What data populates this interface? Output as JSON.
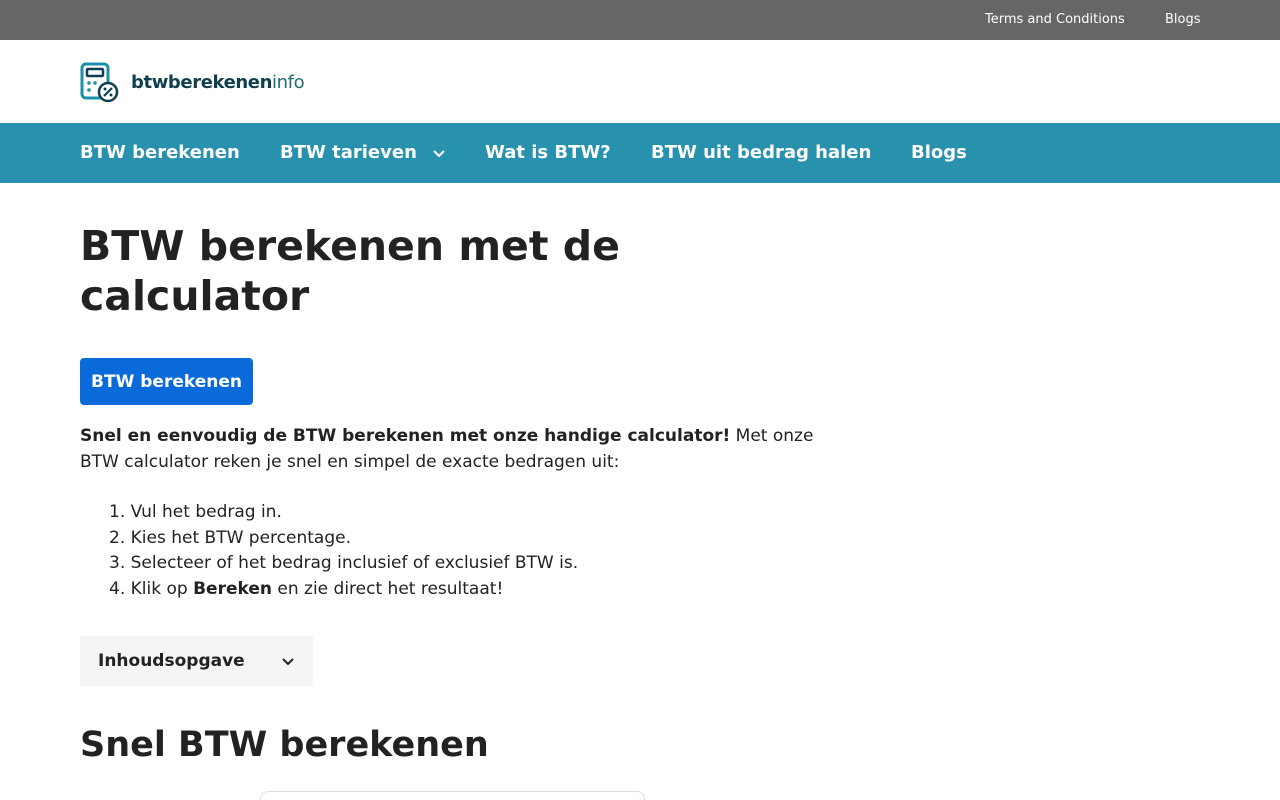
{
  "topbar": {
    "links": [
      "Terms and Conditions",
      "Blogs"
    ]
  },
  "logo": {
    "brand_bold": "btwberekenen",
    "brand_light": "info",
    "icon": "calculator-percent-icon"
  },
  "nav": {
    "items": [
      {
        "label": "BTW berekenen"
      },
      {
        "label": "BTW tarieven",
        "icon": "chevron-down-icon"
      },
      {
        "label": "Wat is BTW?"
      },
      {
        "label": "BTW uit bedrag halen"
      },
      {
        "label": "Blogs"
      }
    ]
  },
  "main": {
    "title": "BTW berekenen met de calculator",
    "cta_label": "BTW berekenen",
    "intro_bold": "Snel en eenvoudig de BTW berekenen met onze handige calculator!",
    "intro_rest": " Met onze BTW calculator reken je snel en simpel de exacte bedragen uit:",
    "steps": [
      {
        "num": "1.",
        "text": "Vul het bedrag in."
      },
      {
        "num": "2.",
        "text": "Kies het BTW percentage."
      },
      {
        "num": "3.",
        "text": "Selecteer of het bedrag inclusief of exclusief BTW is."
      },
      {
        "num": "4.",
        "before": "Klik op ",
        "bold": "Bereken",
        "after": " en zie direct het resultaat!"
      }
    ],
    "toc_label": "Inhoudsopgave",
    "section_title": "Snel BTW berekenen"
  },
  "colors": {
    "topbar": "#666666",
    "nav": "#2892ae",
    "cta": "#0b6ad9",
    "toc_bg": "#f5f5f5"
  }
}
